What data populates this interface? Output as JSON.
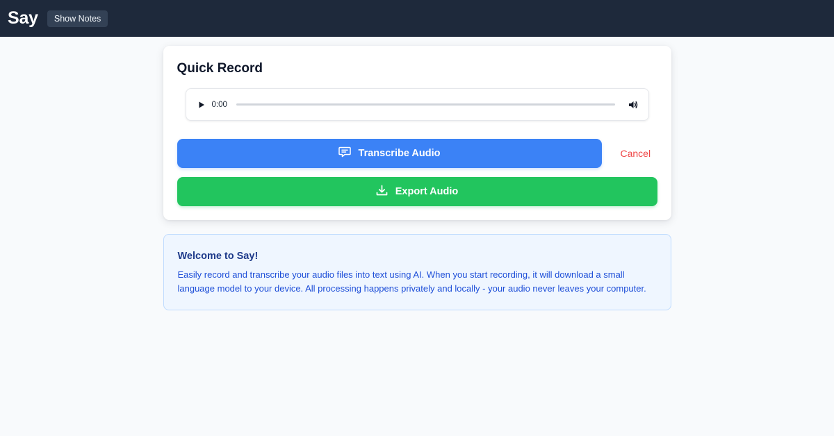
{
  "header": {
    "app_title": "Say",
    "show_notes_label": "Show Notes"
  },
  "recorder": {
    "title": "Quick Record",
    "player": {
      "current_time": "0:00",
      "progress": 0,
      "play_icon": "play-icon",
      "volume_icon": "volume-icon"
    },
    "transcribe_label": "Transcribe Audio",
    "transcribe_icon": "message-icon",
    "cancel_label": "Cancel",
    "export_label": "Export Audio",
    "export_icon": "download-icon"
  },
  "info": {
    "title": "Welcome to Say!",
    "body": "Easily record and transcribe your audio files into text using AI. When you start recording, it will download a small language model to your device. All processing happens privately and locally - your audio never leaves your computer."
  },
  "colors": {
    "topbar": "#1e293b",
    "primary_blue": "#3b82f6",
    "success_green": "#22c55e",
    "danger_red": "#ef4444",
    "info_bg": "#eff6ff"
  }
}
